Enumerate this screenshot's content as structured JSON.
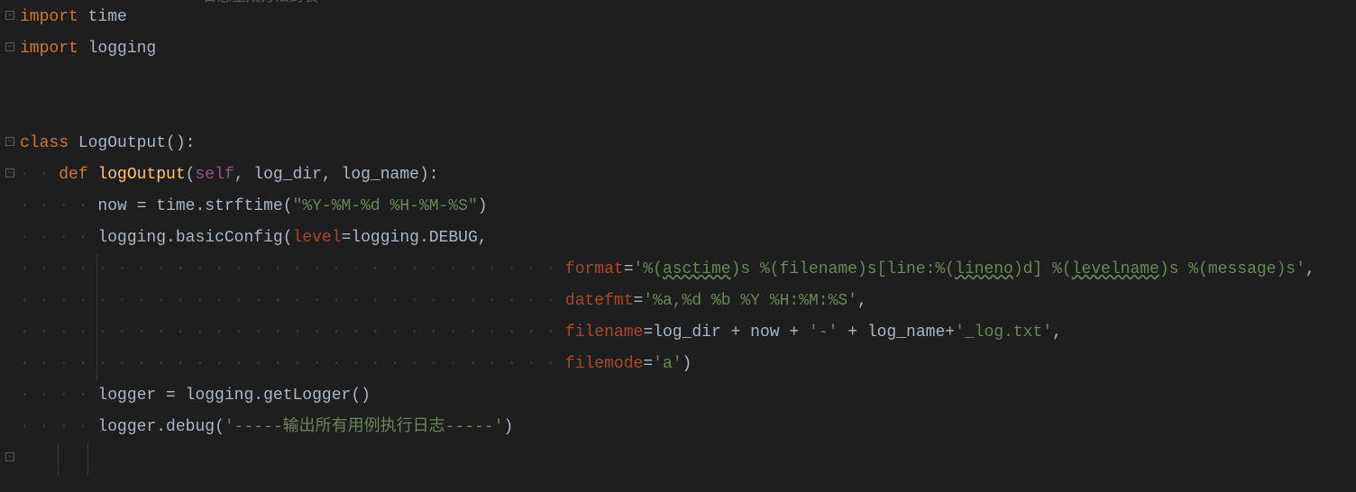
{
  "faded_header": "日志生成方法封装",
  "lines": {
    "l1": {
      "kw1": "import ",
      "mod": "time"
    },
    "l2": {
      "kw1": "import ",
      "mod": "logging"
    },
    "l3": "",
    "l4": "",
    "l5": {
      "kw1": "class ",
      "name": "LogOutput",
      "parens": "():"
    },
    "l6": {
      "indent": "    ",
      "kw1": "def ",
      "name": "logOutput",
      "open": "(",
      "self": "self",
      "c1": ", ",
      "p1": "log_dir",
      "c2": ", ",
      "p2": "log_name",
      "close": "):"
    },
    "l7": {
      "indent": "        ",
      "var": "now ",
      "eq": "= ",
      "mod": "time",
      "dot": ".",
      "fn": "strftime",
      "open": "(",
      "str": "\"%Y-%M-%d %H-%M-%S\"",
      "close": ")"
    },
    "l8": {
      "indent": "        ",
      "mod": "logging",
      "dot": ".",
      "fn": "basicConfig",
      "open": "(",
      "kw1": "level",
      "eq1": "=",
      "mod2": "logging",
      "dot2": ".",
      "attr": "DEBUG",
      "comma": ","
    },
    "l9": {
      "indent": "                            ",
      "kw1": "format",
      "eq": "=",
      "s1": "'%(",
      "w1": "asctime",
      "s2": ")s %(filename)s[line:%(",
      "w2": "lineno",
      "s3": ")d] %(",
      "w3": "levelname",
      "s4": ")s %(message)s'",
      "comma": ","
    },
    "l10": {
      "indent": "                            ",
      "kw1": "datefmt",
      "eq": "=",
      "str": "'%a,%d %b %Y %H:%M:%S'",
      "comma": ","
    },
    "l11": {
      "indent": "                            ",
      "kw1": "filename",
      "eq": "=",
      "v1": "log_dir ",
      "plus1": "+ ",
      "v2": "now ",
      "plus2": "+ ",
      "s1": "'-' ",
      "plus3": "+ ",
      "v3": "log_name",
      "plus4": "+",
      "s2": "'_log.txt'",
      "comma": ","
    },
    "l12": {
      "indent": "                            ",
      "kw1": "filemode",
      "eq": "=",
      "str": "'a'",
      "close": ")"
    },
    "l13": {
      "indent": "        ",
      "var": "logger ",
      "eq": "= ",
      "mod": "logging",
      "dot": ".",
      "fn": "getLogger",
      "parens": "()"
    },
    "l14": {
      "indent": "        ",
      "var": "logger",
      "dot": ".",
      "fn": "debug",
      "open": "(",
      "str": "'-----输出所有用例执行日志-----'",
      "close": ")"
    }
  }
}
